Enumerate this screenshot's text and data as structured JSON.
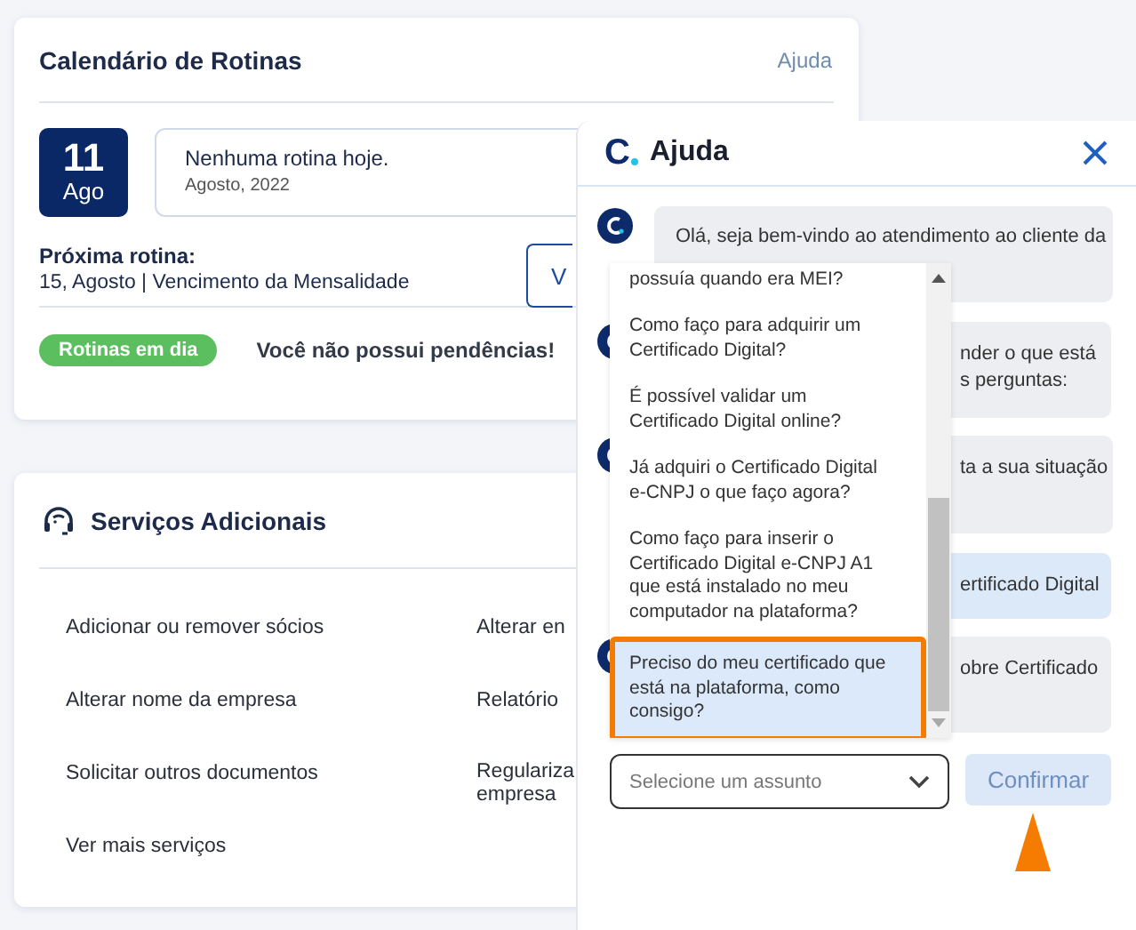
{
  "calendar": {
    "title": "Calendário de Rotinas",
    "help_link": "Ajuda",
    "day": "11",
    "month": "Ago",
    "today_title": "Nenhuma rotina hoje.",
    "today_date": "Agosto, 2022",
    "next_label": "Próxima rotina:",
    "next_value": "15, Agosto | Vencimento da Mensalidade",
    "button": "V",
    "status_badge": "Rotinas em dia",
    "status_text": "Você não possui pendências!"
  },
  "services": {
    "title": "Serviços Adicionais",
    "items": [
      {
        "label": "Adicionar ou remover sócios"
      },
      {
        "label": "Alterar en"
      },
      {
        "label": "Alterar nome da empresa"
      },
      {
        "label": "Relatório"
      },
      {
        "label": "Solicitar outros documentos"
      },
      {
        "label": "Regulariza\nempresa"
      },
      {
        "label": "Ver mais serviços"
      }
    ]
  },
  "help": {
    "logo": "C",
    "title": "Ajuda",
    "messages": [
      {
        "kind": "bot",
        "lines": [
          "Olá, seja bem-vindo ao atendimento ao cliente da"
        ]
      },
      {
        "kind": "bot",
        "lines": [
          "nder o que está",
          "s perguntas:"
        ]
      },
      {
        "kind": "bot",
        "lines": [
          "ta a sua situação"
        ]
      },
      {
        "kind": "user",
        "lines": [
          "ertificado Digital"
        ]
      },
      {
        "kind": "bot",
        "lines": [
          "obre Certificado"
        ]
      }
    ],
    "options": [
      {
        "label": "possuía quando era MEI?",
        "selected": false
      },
      {
        "label": "Como faço para adquirir um Certificado Digital?",
        "selected": false
      },
      {
        "label": "É possível validar um Certificado Digital online?",
        "selected": false
      },
      {
        "label": "Já adquiri o Certificado Digital e-CNPJ o que faço agora?",
        "selected": false
      },
      {
        "label": "Como faço para inserir o Certificado Digital e-CNPJ A1 que está instalado no meu computador na plataforma?",
        "selected": false
      },
      {
        "label": "Preciso do meu certificado que está na plataforma, como consigo?",
        "selected": true
      }
    ],
    "select": {
      "placeholder": "Selecione um assunto"
    },
    "confirm": {
      "label": "Confirmar",
      "disabled": true
    }
  }
}
